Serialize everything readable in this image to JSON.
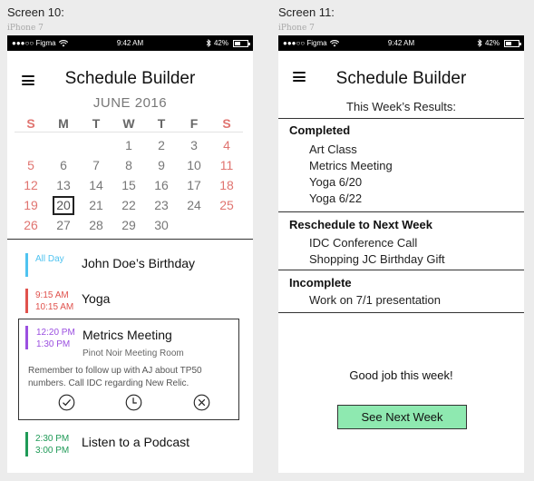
{
  "screens": [
    {
      "label": "Screen 10:",
      "device": "iPhone 7"
    },
    {
      "label": "Screen 11:",
      "device": "iPhone 7"
    }
  ],
  "status_bar": {
    "carrier": "●●●○○ Figma",
    "time": "9:42 AM",
    "battery": "42%"
  },
  "app": {
    "title": "Schedule Builder"
  },
  "calendar": {
    "month": "JUNE 2016",
    "weekdays": [
      "S",
      "M",
      "T",
      "W",
      "T",
      "F",
      "S"
    ],
    "weeks": [
      [
        "",
        "",
        "",
        "1",
        "2",
        "3",
        "4"
      ],
      [
        "5",
        "6",
        "7",
        "8",
        "9",
        "10",
        "11"
      ],
      [
        "12",
        "13",
        "14",
        "15",
        "16",
        "17",
        "18"
      ],
      [
        "19",
        "20",
        "21",
        "22",
        "23",
        "24",
        "25"
      ],
      [
        "26",
        "27",
        "28",
        "29",
        "30",
        "",
        ""
      ]
    ],
    "selected_day": "20"
  },
  "events": [
    {
      "time_start": "All Day",
      "time_end": "",
      "title": "John Doe’s Birthday",
      "color": "#4fc3f0"
    },
    {
      "time_start": "9:15 AM",
      "time_end": "10:15 AM",
      "title": "Yoga",
      "color": "#e0524d"
    },
    {
      "time_start": "12:20 PM",
      "time_end": "1:30 PM",
      "title": "Metrics Meeting",
      "color": "#9b4fe0",
      "location": "Pinot Noir Meeting Room",
      "note": "Remember to follow up with AJ about TP50 numbers. Call IDC regarding New Relic."
    },
    {
      "time_start": "2:30 PM",
      "time_end": "3:00 PM",
      "title": "Listen to a Podcast",
      "color": "#1f9a57"
    }
  ],
  "results": {
    "subtitle": "This Week’s Results:",
    "sections": [
      {
        "heading": "Completed",
        "items": [
          "Art Class",
          "Metrics Meeting",
          "Yoga 6/20",
          "Yoga 6/22"
        ]
      },
      {
        "heading": "Reschedule to Next Week",
        "items": [
          "IDC Conference Call",
          "Shopping JC Birthday Gift"
        ]
      },
      {
        "heading": "Incomplete",
        "items": [
          "Work on 7/1 presentation"
        ]
      }
    ],
    "closing": "Good job this week!",
    "button": "See Next Week"
  },
  "icons": [
    "menu-icon",
    "wifi-icon",
    "bluetooth-icon",
    "battery-icon",
    "check-circle-icon",
    "clock-icon",
    "x-circle-icon"
  ]
}
